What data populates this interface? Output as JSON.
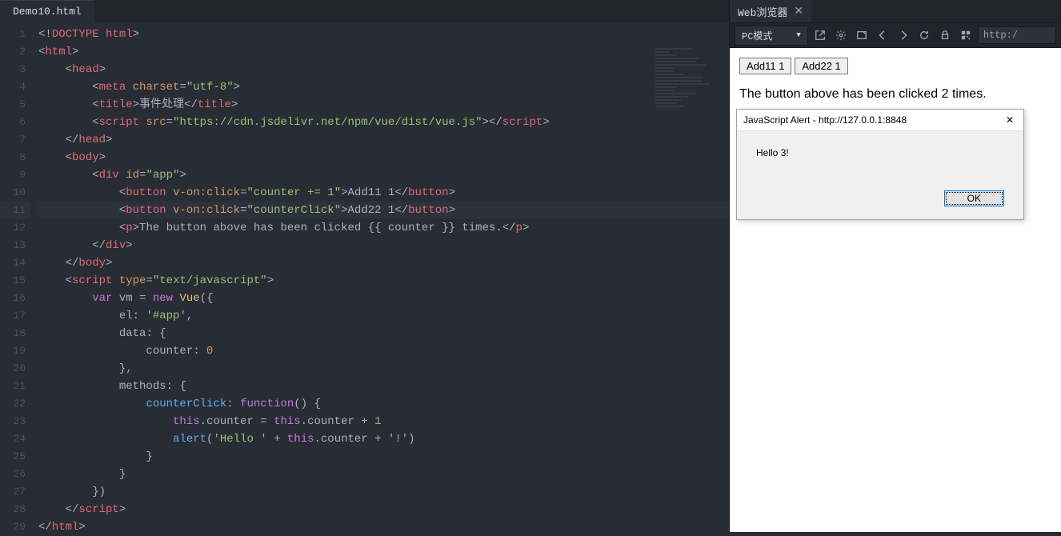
{
  "editor": {
    "tab": "Demo10.html",
    "lines": [
      "1",
      "2",
      "3",
      "4",
      "5",
      "6",
      "7",
      "8",
      "9",
      "10",
      "11",
      "12",
      "13",
      "14",
      "15",
      "16",
      "17",
      "18",
      "19",
      "20",
      "21",
      "22",
      "23",
      "24",
      "25",
      "26",
      "27",
      "28",
      "29"
    ],
    "code": {
      "l1_doctype": "DOCTYPE html",
      "l2_tag": "html",
      "l3_tag": "head",
      "l4_tag": "meta",
      "l4_attr": "charset",
      "l4_val": "\"utf-8\"",
      "l5_tag": "title",
      "l5_text": "事件处理",
      "l6_tag": "script",
      "l6_attr": "src",
      "l6_val": "\"https://cdn.jsdelivr.net/npm/vue/dist/vue.js\"",
      "l7_tag": "head",
      "l8_tag": "body",
      "l9_tag": "div",
      "l9_attr": "id",
      "l9_val": "\"app\"",
      "l10_tag": "button",
      "l10_attr": "v-on:click",
      "l10_val": "\"counter += 1\"",
      "l10_text": "Add11 1",
      "l11_tag": "button",
      "l11_attr": "v-on:click",
      "l11_val": "\"counterClick\"",
      "l11_text": "Add22 1",
      "l12_tag": "p",
      "l12_text_a": "The button above has been clicked ",
      "l12_expr": "{{ counter }}",
      "l12_text_b": " times.",
      "l13_tag": "div",
      "l14_tag": "body",
      "l15_tag": "script",
      "l15_attr": "type",
      "l15_val": "\"text/javascript\"",
      "l16_kw_var": "var",
      "l16_vm": "vm",
      "l16_eq": " = ",
      "l16_kw_new": "new",
      "l16_vue": "Vue",
      "l17_el": "el",
      "l17_val": "'#app'",
      "l18_data": "data",
      "l19_counter": "counter",
      "l19_val": "0",
      "l21_methods": "methods",
      "l22_fn": "counterClick",
      "l22_kw": "function",
      "l23_this1": "this",
      "l23_c1": ".counter = ",
      "l23_this2": "this",
      "l23_c2": ".counter + ",
      "l23_one": "1",
      "l24_alert": "alert",
      "l24_s1": "'Hello '",
      "l24_this": "this",
      "l24_prop": ".counter",
      "l24_s2": "'!'",
      "l28_tag": "script",
      "l29_tag": "html"
    }
  },
  "browser": {
    "tab_title": "Web浏览器",
    "mode": "PC模式",
    "url": "http:/",
    "page": {
      "btn1": "Add11 1",
      "btn2": "Add22 1",
      "text": "The button above has been clicked 2 times."
    },
    "alert": {
      "title": "JavaScript Alert - http://127.0.0.1:8848",
      "message": "Hello 3!",
      "ok": "OK"
    }
  }
}
